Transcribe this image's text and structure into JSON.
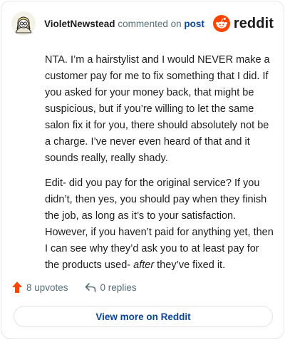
{
  "header": {
    "username": "VioletNewstead",
    "action_text": "commented on",
    "post_link_label": "post",
    "brand_name": "reddit",
    "avatar_icon": "snoo-avatar-icon",
    "brand_icon": "reddit-logo-icon"
  },
  "comment": {
    "paragraph_1": "NTA. I’m a hairstylist and I would NEVER make a customer pay for me to fix something that I did. If you asked for your money back, that might be suspicious, but if you’re willing to let the same salon fix it for you, there should absolutely not be a charge. I’ve never even heard of that and it sounds really, really shady.",
    "paragraph_2_before": "Edit- did you pay for the original service? If you didn’t, then yes, you should pay when they finish the job, as long as it’s to your satisfaction. However, if you haven’t paid for anything yet, then I can see why they’d ask you to at least pay for the products used- ",
    "paragraph_2_emphasis": "after",
    "paragraph_2_after": " they’ve fixed it."
  },
  "footer": {
    "upvotes_label": "8 upvotes",
    "replies_label": "0 replies",
    "upvote_icon": "upvote-arrow-icon",
    "reply_icon": "reply-arrow-icon"
  },
  "view_more_label": "View more on Reddit",
  "colors": {
    "brand_orange": "#ff4500",
    "link_blue": "#0a449b",
    "meta_gray": "#576f76",
    "text": "#1c1c1c"
  }
}
